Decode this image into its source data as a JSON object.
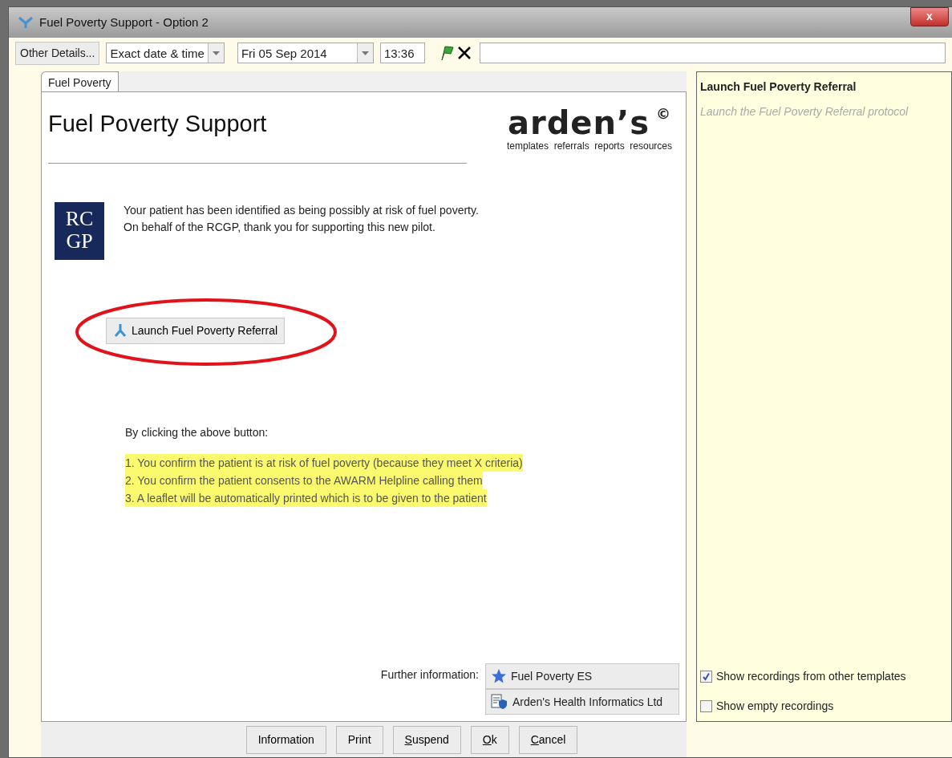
{
  "window": {
    "title": "Fuel Poverty Support - Option 2",
    "close": "x"
  },
  "toolbar": {
    "other_details": "Other Details...",
    "date_mode": "Exact date & time",
    "date": "Fri 05 Sep 2014",
    "time": "13:36"
  },
  "tabs": [
    {
      "label": "Fuel Poverty",
      "selected": true
    }
  ],
  "form": {
    "heading": "Fuel Poverty Support",
    "brand": {
      "name": "arden’s",
      "mark": "©",
      "tagline": "templates  referrals  reports  resources"
    },
    "org_logo": [
      "RC",
      "GP"
    ],
    "intro": [
      "Your patient has been identified as being possibly at risk of fuel poverty.",
      "On behalf of the RCGP, thank you for supporting this new pilot."
    ],
    "launch_button": "Launch Fuel Poverty Referral",
    "by_clicking": "By clicking the above button:",
    "points": [
      {
        "text": "1. You confirm the patient is at risk of fuel poverty (because they meet X criteria)",
        "highlighted": true
      },
      {
        "text": "2. You confirm the patient consents to the AWARM Helpline calling them",
        "highlighted": true
      },
      {
        "text": "3. A leaflet will be automatically printed which is to be given to the patient",
        "highlighted": true
      }
    ],
    "further_label": "Further information:",
    "further_links": [
      {
        "kind": "star",
        "label": "Fuel Poverty ES"
      },
      {
        "kind": "document",
        "label": "Arden's Health Informatics Ltd"
      }
    ]
  },
  "side_panel": {
    "title": "Launch Fuel Poverty Referral",
    "description": "Launch the Fuel Poverty Referral protocol",
    "options": [
      {
        "label": "Show recordings from other templates",
        "checked": true
      },
      {
        "label": "Show empty recordings",
        "checked": false
      }
    ]
  },
  "buttons": [
    {
      "label": "Information",
      "mnemonic": false
    },
    {
      "label": "Print",
      "mnemonic": false
    },
    {
      "label": "Suspend",
      "mnemonic": true
    },
    {
      "label": "Ok",
      "mnemonic": true
    },
    {
      "label": "Cancel",
      "mnemonic": true
    }
  ]
}
